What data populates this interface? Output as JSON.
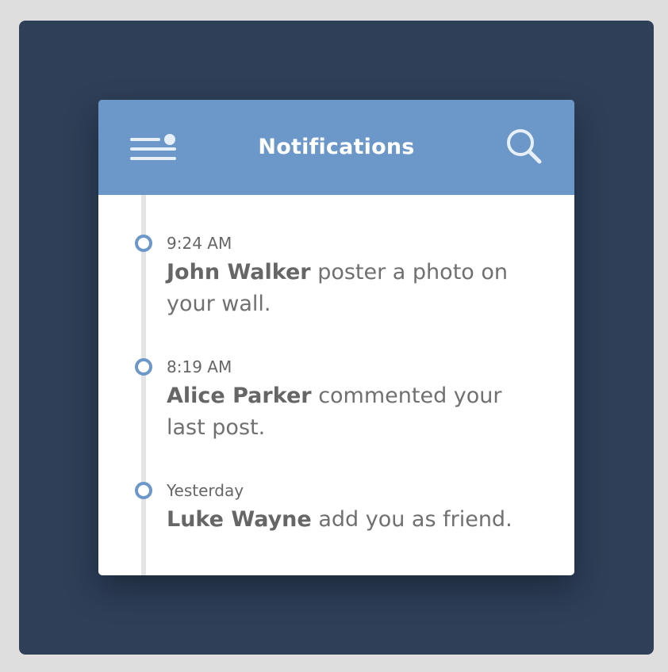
{
  "header": {
    "title": "Notifications",
    "menu_icon": "menu-icon",
    "search_icon": "search-icon",
    "color": "#6b97c9"
  },
  "notifications": [
    {
      "time": "9:24 AM",
      "name": "John Walker",
      "text": "poster a photo on your wall."
    },
    {
      "time": "8:19 AM",
      "name": "Alice Parker",
      "text": "commented your last post."
    },
    {
      "time": "Yesterday",
      "name": "Luke Wayne",
      "text": "add you as friend."
    }
  ],
  "colors": {
    "page_background": "#dedede",
    "stage_background": "#2e3f57",
    "card_background": "#ffffff",
    "accent": "#6b97c9",
    "timeline": "#e4e4e4",
    "text": "#707070"
  }
}
